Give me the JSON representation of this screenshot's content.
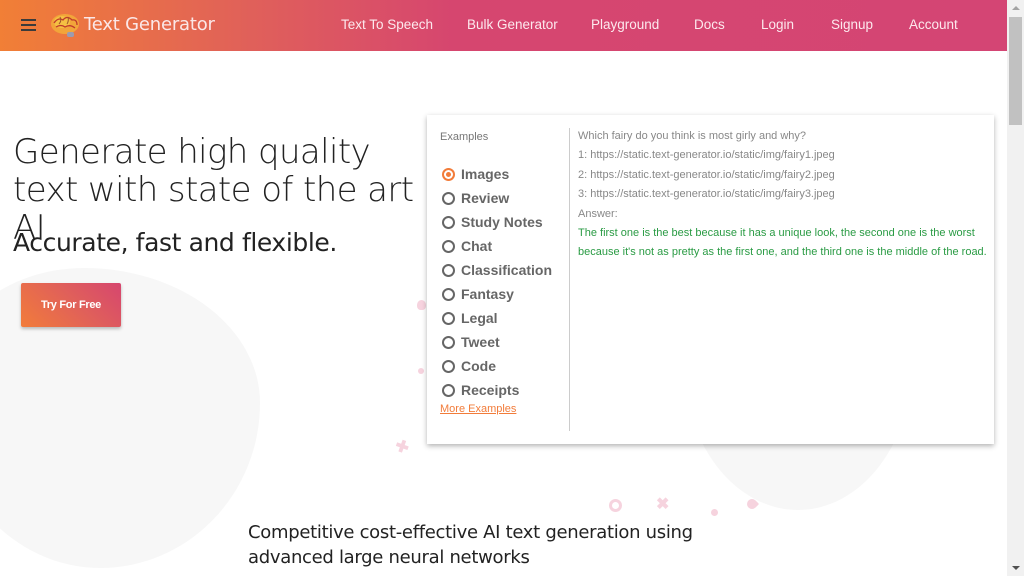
{
  "header": {
    "brand": "Text Generator",
    "nav": [
      {
        "label": "Text To Speech"
      },
      {
        "label": "Bulk Generator"
      },
      {
        "label": "Playground"
      },
      {
        "label": "Docs"
      },
      {
        "label": "Login"
      },
      {
        "label": "Signup"
      },
      {
        "label": "Account"
      }
    ]
  },
  "hero": {
    "title": "Generate high quality text with state of the art AI",
    "subtitle": "Accurate, fast and flexible.",
    "cta_label": "Try For Free"
  },
  "examples": {
    "label": "Examples",
    "selected": "Images",
    "options": [
      {
        "label": "Images",
        "checked": true
      },
      {
        "label": "Review",
        "checked": false
      },
      {
        "label": "Study Notes",
        "checked": false
      },
      {
        "label": "Chat",
        "checked": false
      },
      {
        "label": "Classification",
        "checked": false
      },
      {
        "label": "Fantasy",
        "checked": false
      },
      {
        "label": "Legal",
        "checked": false
      },
      {
        "label": "Tweet",
        "checked": false
      },
      {
        "label": "Code",
        "checked": false
      },
      {
        "label": "Receipts",
        "checked": false
      }
    ],
    "more_label": "More Examples",
    "prompt_lines": [
      "Which fairy do you think is most girly and why?",
      "1: https://static.text-generator.io/static/img/fairy1.jpeg",
      "2: https://static.text-generator.io/static/img/fairy2.jpeg",
      "3: https://static.text-generator.io/static/img/fairy3.jpeg",
      "Answer:"
    ],
    "answer": "The first one is the best because it has a unique look, the second one is the worst because it's not as pretty as the first one, and the third one is the middle of the road."
  },
  "tagline": "Competitive cost-effective AI text generation using advanced large neural networks",
  "colors": {
    "accent_orange": "#f27c3a",
    "accent_pink": "#d6466f",
    "answer_green": "#2a9b44"
  },
  "icons": {
    "menu": "hamburger-icon",
    "logo": "brain-icon"
  }
}
